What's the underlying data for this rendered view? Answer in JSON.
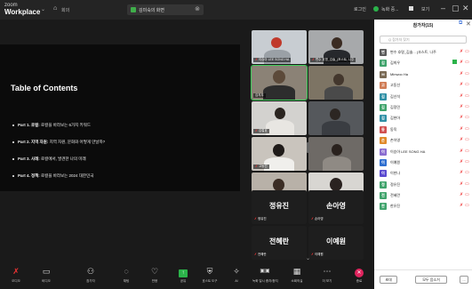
{
  "titlebar": {
    "brand_line1": "zoom",
    "brand_line2": "Workplace",
    "home_label": "회의",
    "tab_label": "김미숙의 화면",
    "login_label": "로그인",
    "recording_label": "녹화 중...",
    "view_label": "보기"
  },
  "slide": {
    "title": "Table of Contents",
    "items": [
      {
        "bold": "Part 1. 로컬:",
        "rest": " 로컬을 바라보는 6가지 키워드"
      },
      {
        "bold": "Part 2. 지역 자원:",
        "rest": " 지역 자원, 문화와 어떻게 만날까?"
      },
      {
        "bold": "Part 3. 사례:",
        "rest": " 로컬에서, 발견한 나의 미래"
      },
      {
        "bold": "Part 4. 정책:",
        "rest": " 로컬을 바라보는 2024 대한민국"
      }
    ]
  },
  "videos": [
    {
      "name": "이승아 LEE SONG HA"
    },
    {
      "name": "변수 호명_김솔_(조스트, 나주"
    },
    {
      "name": "김지우"
    },
    {
      "name": ""
    },
    {
      "name": "김철호"
    },
    {
      "name": ""
    },
    {
      "name": "고동선"
    },
    {
      "name": ""
    },
    {
      "name": "이동식"
    },
    {
      "name": "이한나"
    }
  ],
  "name_tiles": [
    {
      "big": "정유진",
      "small": "정유진"
    },
    {
      "big": "손아영",
      "small": "손아영"
    },
    {
      "big": "전혜란",
      "small": "전혜란"
    },
    {
      "big": "이예원",
      "small": "이예원"
    }
  ],
  "toolbar": {
    "items": [
      {
        "icon": "mic-off-icon",
        "glyph": "🎙",
        "label": "오디오"
      },
      {
        "icon": "video-icon",
        "glyph": "▭",
        "label": "비디오"
      },
      {
        "icon": "participants-icon",
        "glyph": "👥",
        "label": "참가자"
      },
      {
        "icon": "chat-icon",
        "glyph": "💬",
        "label": "채팅"
      },
      {
        "icon": "reaction-icon",
        "glyph": "♡",
        "label": "반응"
      },
      {
        "icon": "share-icon",
        "glyph": "↑",
        "label": "공유"
      },
      {
        "icon": "host-tools-icon",
        "glyph": "⛨",
        "label": "호스트 도구"
      },
      {
        "icon": "ai-companion-icon",
        "glyph": "✧",
        "label": "AI"
      },
      {
        "icon": "captions-icon",
        "glyph": "CC",
        "label": "녹화 일시 중지/중지"
      },
      {
        "icon": "apps-icon",
        "glyph": "▦",
        "label": "소회의실"
      },
      {
        "icon": "more-icon",
        "glyph": "…",
        "label": "더 보기"
      },
      {
        "icon": "end-icon",
        "glyph": "✕",
        "label": "종료"
      }
    ]
  },
  "panel": {
    "title": "참가자(15)",
    "search_placeholder": "Q 참가자 찾기",
    "participants": [
      {
        "name": "변수 호명_김솔... (조스트, 나주",
        "initial": "변",
        "color": "#5a5a5a"
      },
      {
        "name": "김희우",
        "initial": "김",
        "color": "#3fa36b"
      },
      {
        "name": "Minwoo Ha",
        "initial": "M",
        "color": "#7a6a55"
      },
      {
        "name": "고동선",
        "initial": "고",
        "color": "#d07c55"
      },
      {
        "name": "김선석",
        "initial": "김",
        "color": "#2e8fa5"
      },
      {
        "name": "김정민",
        "initial": "김",
        "color": "#3fa36b"
      },
      {
        "name": "김현아",
        "initial": "김",
        "color": "#2e8fa5"
      },
      {
        "name": "동욱",
        "initial": "동",
        "color": "#d05050"
      },
      {
        "name": "손아영",
        "initial": "손",
        "color": "#e08a2a"
      },
      {
        "name": "이승아 LEE SONG HA",
        "initial": "이",
        "color": "#8a6cd0"
      },
      {
        "name": "이예원",
        "initial": "이",
        "color": "#2e6ed0"
      },
      {
        "name": "이한나",
        "initial": "이",
        "color": "#5a4ad0"
      },
      {
        "name": "정유진",
        "initial": "정",
        "color": "#3fa36b"
      },
      {
        "name": "전혜란",
        "initial": "전",
        "color": "#3fa36b"
      },
      {
        "name": "한유진",
        "initial": "한",
        "color": "#3fa36b"
      }
    ],
    "invite_label": "초대",
    "mute_all_label": "모두 음소거",
    "more_label": "..."
  }
}
